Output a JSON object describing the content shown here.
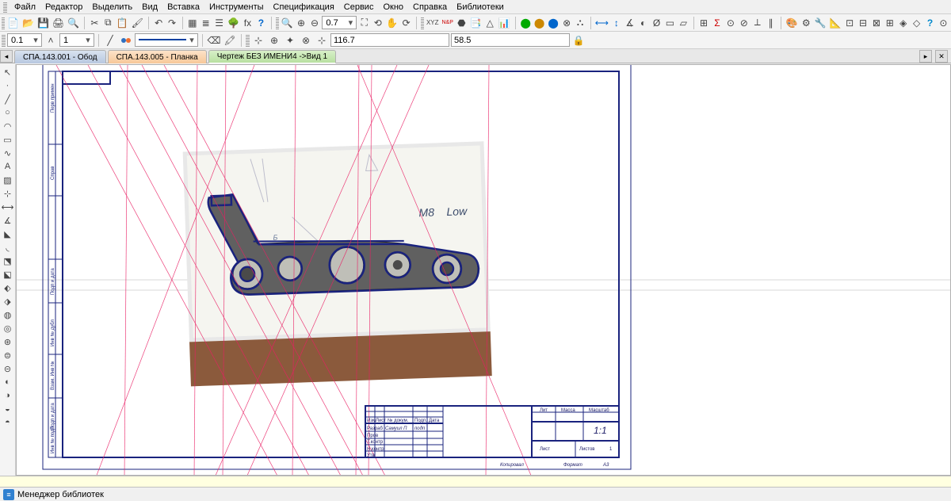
{
  "menu": {
    "file": "Файл",
    "edit": "Редактор",
    "select": "Выделить",
    "view": "Вид",
    "insert": "Вставка",
    "tools": "Инструменты",
    "spec": "Спецификация",
    "service": "Сервис",
    "window": "Окно",
    "help": "Справка",
    "libs": "Библиотеки"
  },
  "tb1": {
    "zoom": "0.7"
  },
  "tb2": {
    "step": "0.1",
    "stepQty": "1",
    "coordX": "116.7",
    "coordY": "58.5"
  },
  "tabs": {
    "t1": "СПА.143.001 - Обод",
    "t2": "СПА.143.005 - Планка",
    "t3": "Чертеж БЕЗ ИМЕНИ4 ->Вид 1"
  },
  "drawing": {
    "titles": {
      "col_izm": "Изм",
      "col_list": "Лист",
      "col_ndoc": "№ докум.",
      "col_podp": "Подп.",
      "col_data": "Дата",
      "row_razrab": "Разраб",
      "row_prov": "Пров",
      "row_tkontr": "Т.контр",
      "row_nkontr": "Н.контр",
      "row_utv": "Утв",
      "lit": "Лит",
      "massa": "Масса",
      "masshtab": "Масштаб",
      "scale_val": "1:1",
      "list": "Лист",
      "listov": "Листов",
      "listov_val": "1",
      "kopiroval": "Копировал",
      "format": "Формат",
      "a3": "А3",
      "side_inv": "Инв № подп",
      "side_podp": "Подп и дата",
      "side_vzam": "Взам. Инв №",
      "side_dubl": "Инв № дубл",
      "side_podp2": "Подп и дата",
      "side_spra": "Справ",
      "side_perv": "Перв примен"
    },
    "photo_note1": "M8",
    "photo_note2": "Low"
  },
  "status": {
    "libmgr": "Менеджер библиотек"
  }
}
